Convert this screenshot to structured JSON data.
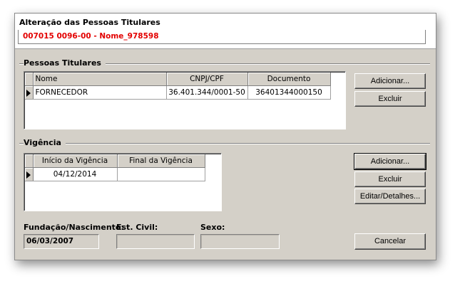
{
  "header": {
    "title": "Alteração das Pessoas Titulares",
    "subtitle": "007015 0096-00 - Nome_978598"
  },
  "titulares": {
    "section_label": "Pessoas Titulares",
    "columns": [
      "Nome",
      "CNPJ/CPF",
      "Documento"
    ],
    "rows": [
      {
        "nome": "FORNECEDOR",
        "cnpj_cpf": "36.401.344/0001-50",
        "documento": "36401344000150"
      }
    ],
    "add_label": "Adicionar...",
    "delete_label": "Excluir"
  },
  "vigencia": {
    "section_label": "Vigência",
    "columns": [
      "Início da Vigência",
      "Final da Vigência"
    ],
    "rows": [
      {
        "inicio": "04/12/2014",
        "final": ""
      }
    ],
    "add_label": "Adicionar...",
    "delete_label": "Excluir",
    "edit_label": "Editar/Detalhes..."
  },
  "details": {
    "fundacao_label": "Fundação/Nascimento:",
    "fundacao_value": "06/03/2007",
    "est_civil_label": "Est. Civil:",
    "est_civil_value": "",
    "sexo_label": "Sexo:",
    "sexo_value": ""
  },
  "footer": {
    "cancel_label": "Cancelar"
  },
  "colors": {
    "subtitle": "#e30000",
    "dialog_bg": "#d4d0c8"
  }
}
